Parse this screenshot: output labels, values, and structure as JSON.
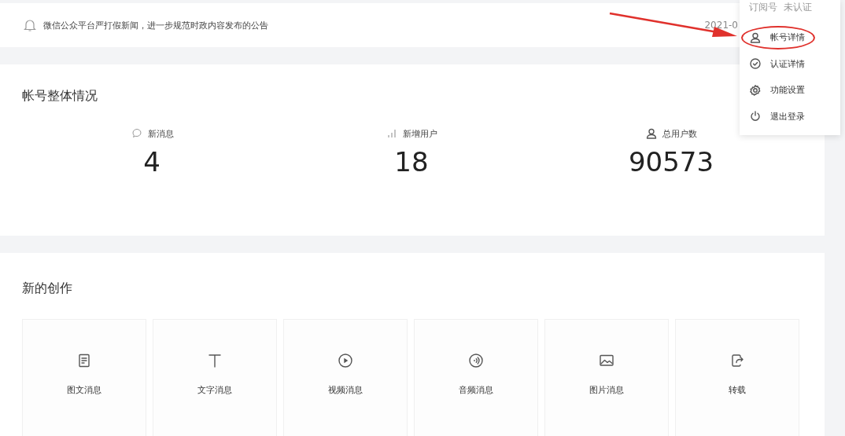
{
  "notice": {
    "text": "微信公众平台严打假新闻，进一步规范时政内容发布的公告",
    "date": "2021-0"
  },
  "overview": {
    "title": "帐号整体情况",
    "stats": [
      {
        "kind": "message",
        "label": "新消息",
        "value": "4"
      },
      {
        "kind": "chart",
        "label": "新增用户",
        "value": "18"
      },
      {
        "kind": "user",
        "label": "总用户数",
        "value": "90573"
      }
    ]
  },
  "create": {
    "title": "新的创作",
    "items": [
      {
        "kind": "article",
        "label": "图文消息"
      },
      {
        "kind": "text",
        "label": "文字消息"
      },
      {
        "kind": "video",
        "label": "视频消息"
      },
      {
        "kind": "audio",
        "label": "音频消息"
      },
      {
        "kind": "image",
        "label": "图片消息"
      },
      {
        "kind": "repost",
        "label": "转载"
      }
    ]
  },
  "account_menu": {
    "type": "订阅号",
    "status": "未认证",
    "items": [
      {
        "kind": "user",
        "label": "帐号详情",
        "highlighted": true
      },
      {
        "kind": "check",
        "label": "认证详情",
        "highlighted": false
      },
      {
        "kind": "gear",
        "label": "功能设置",
        "highlighted": false
      },
      {
        "kind": "power",
        "label": "退出登录",
        "highlighted": false
      }
    ]
  }
}
